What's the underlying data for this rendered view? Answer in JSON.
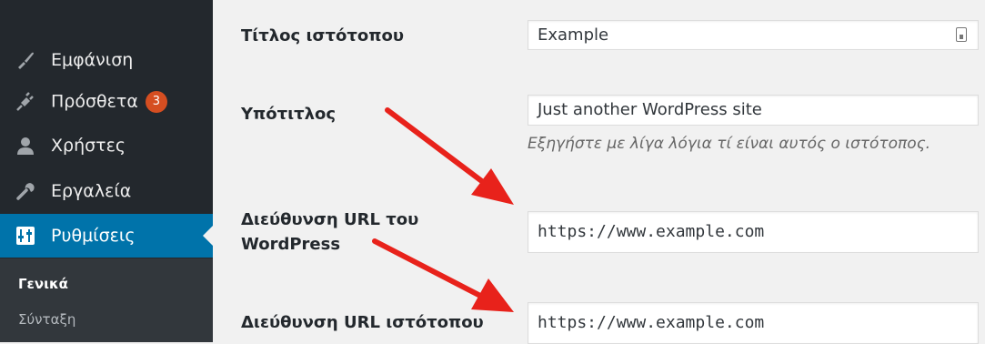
{
  "sidebar": {
    "items": [
      {
        "icon": "paintbrush-icon",
        "label": "Εμφάνιση"
      },
      {
        "icon": "plugin-icon",
        "label": "Πρόσθετα",
        "badge": "3"
      },
      {
        "icon": "users-icon",
        "label": "Χρήστες"
      },
      {
        "icon": "wrench-icon",
        "label": "Εργαλεία"
      },
      {
        "icon": "settings-icon",
        "label": "Ρυθμίσεις",
        "active": true
      }
    ],
    "submenu": [
      {
        "label": "Γενικά",
        "current": true
      },
      {
        "label": "Σύνταξη"
      }
    ]
  },
  "settings": {
    "site_title": {
      "label": "Τίτλος ιστότοπου",
      "value": "Example"
    },
    "tagline": {
      "label": "Υπότιτλος",
      "value": "Just another WordPress site",
      "description": "Εξηγήστε με λίγα λόγια τί είναι αυτός ο ιστότοπος."
    },
    "wp_url": {
      "label_line1": "Διεύθυνση URL του",
      "label_line2": "WordPress",
      "value": "https://www.example.com"
    },
    "site_url": {
      "label": "Διεύθυνση URL ιστότοπου",
      "value": "https://www.example.com"
    }
  },
  "colors": {
    "sidebar_bg": "#23282d",
    "active_bg": "#0073aa",
    "badge_bg": "#d54e21",
    "arrow": "#e8221b"
  }
}
